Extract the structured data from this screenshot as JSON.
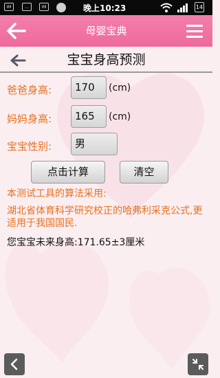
{
  "status_bar": {
    "notification_icons": [
      "IM",
      "msg",
      "IM"
    ],
    "time": "晚上10:23",
    "battery": "14"
  },
  "header": {
    "title": "母婴宝典"
  },
  "page": {
    "title": "宝宝身高预测"
  },
  "form": {
    "father_label": "爸爸身高:",
    "father_value": "170",
    "mother_label": "妈妈身高:",
    "mother_value": "165",
    "unit": "(cm)",
    "gender_label": "宝宝性别:",
    "gender_value": "男"
  },
  "buttons": {
    "calculate": "点击计算",
    "clear": "清空"
  },
  "info": {
    "line1": "本测试工具的算法采用:",
    "line2": "湖北省体育科学研究校正的哈弗利采克公式,更适用于我国国民."
  },
  "result": {
    "text": "您宝宝未来身高:171.65±3厘米"
  },
  "colors": {
    "header_pink": "#ee6a9c",
    "label_orange": "#e5711f"
  }
}
